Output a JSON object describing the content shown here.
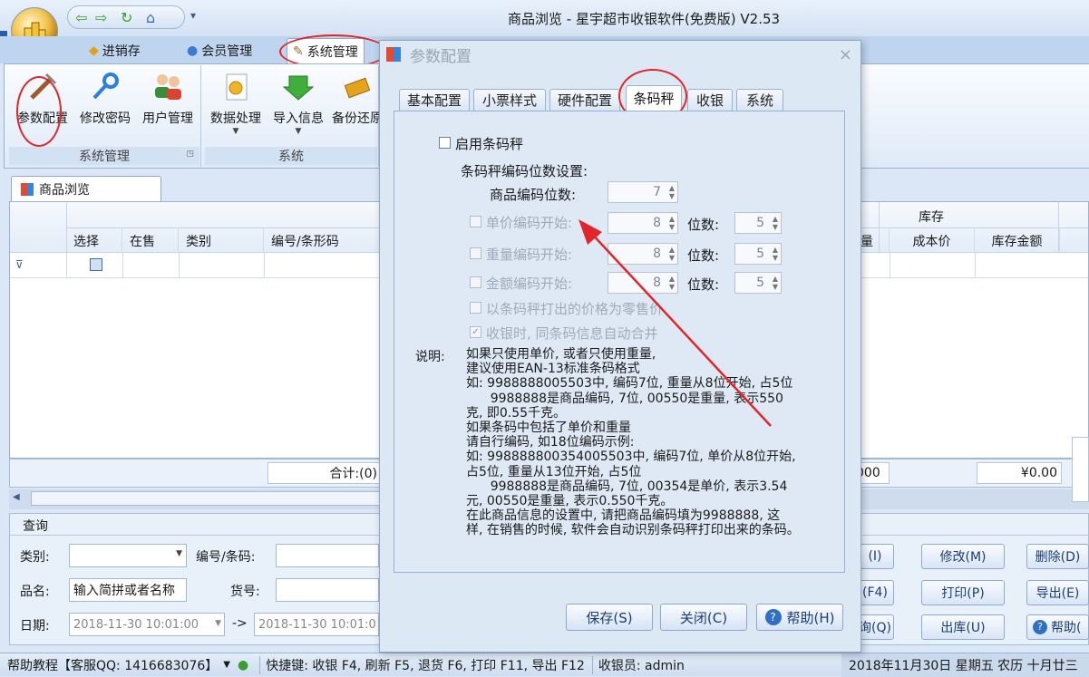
{
  "window": {
    "title": "商品浏览 - 星宇超市收银软件(免费版) V2.53"
  },
  "ribbon": {
    "tabs": [
      {
        "label": "进销存"
      },
      {
        "label": "会员管理"
      },
      {
        "label": "系统管理"
      }
    ],
    "groups": [
      {
        "label": "系统管理",
        "buttons": [
          {
            "label": "参数配置"
          },
          {
            "label": "修改密码"
          },
          {
            "label": "用户管理"
          }
        ]
      },
      {
        "label": "系统",
        "buttons": [
          {
            "label": "数据处理"
          },
          {
            "label": "导入信息"
          },
          {
            "label": "备份还原"
          }
        ]
      }
    ]
  },
  "doc_tab": {
    "label": "商品浏览"
  },
  "grid": {
    "group_header": "库存",
    "columns": [
      "选择",
      "在售",
      "类别",
      "编号/条形码",
      "量",
      "成本价",
      "库存金额"
    ],
    "sum_label": "合计:(0)",
    "sum_qty": "000",
    "sum_amount": "¥0.00"
  },
  "query": {
    "title": "查询",
    "category_label": "类别:",
    "code_label": "编号/条码:",
    "name_label": "品名:",
    "name_value": "输入简拼或者名称",
    "cargo_label": "货号:",
    "date_label": "日期:",
    "date_from": "2018-11-30 10:01:00",
    "date_sep": "->",
    "date_to": "2018-11-30 10:01:0",
    "buttons": {
      "add": "(I)",
      "edit": "修改(M)",
      "delete": "删除(D)",
      "f4": "(F4)",
      "print": "打印(P)",
      "export": "导出(E)",
      "query": "询(Q)",
      "outstock": "出库(U)",
      "help": "帮助("
    }
  },
  "status": {
    "help": "帮助教程【客服QQ: 1416683076】",
    "shortcuts": "快捷键: 收银 F4, 刷新 F5, 退货 F6, 打印 F11, 导出 F12",
    "cashier": "收银员: admin",
    "date": "2018年11月30日 星期五 农历 十月廿三"
  },
  "dialog": {
    "title": "参数配置",
    "close": "×",
    "tabs": [
      {
        "label": "基本配置"
      },
      {
        "label": "小票样式"
      },
      {
        "label": "硬件配置"
      },
      {
        "label": "条码秤"
      },
      {
        "label": "收银"
      },
      {
        "label": "系统"
      }
    ],
    "enable_label": "启用条码秤",
    "section_label": "条码秤编码位数设置:",
    "code_digits_label": "商品编码位数:",
    "code_digits_value": "7",
    "unit_price_label": "单价编码开始:",
    "unit_price_start": "8",
    "unit_price_digits": "5",
    "weight_label": "重量编码开始:",
    "weight_start": "8",
    "weight_digits": "5",
    "amount_label": "金额编码开始:",
    "amount_start": "8",
    "amount_digits": "5",
    "digits_label": "位数:",
    "use_scale_price_label": "以条码秤打出的价格为零售价",
    "merge_label": "收银时, 同条码信息自动合并",
    "note_label": "说明:",
    "note_lines": [
      "如果只使用单价, 或者只使用重量,",
      "建议使用EAN-13标准条码格式",
      "如: 9988888005503中, 编码7位, 重量从8位开始, 占5位",
      "      9988888是商品编码, 7位, 00550是重量, 表示550",
      "克, 即0.55千克。",
      "如果条码中包括了单价和重量",
      "请自行编码, 如18位编码示例:",
      "如: 998888800354005503中, 编码7位, 单价从8位开始,",
      "占5位, 重量从13位开始, 占5位",
      "      9988888是商品编码, 7位, 00354是单价, 表示3.54",
      "元, 00550是重量, 表示0.550千克。",
      "在此商品信息的设置中, 请把商品编码填为9988888, 这",
      "样, 在销售的时候, 软件会自动识别条码秤打印出来的条码。"
    ],
    "buttons": {
      "save": "保存(S)",
      "close": "关闭(C)",
      "help": "帮助(H)"
    }
  },
  "colors": {
    "annotation": "#e0262a",
    "accent": "#2a5fa8"
  }
}
